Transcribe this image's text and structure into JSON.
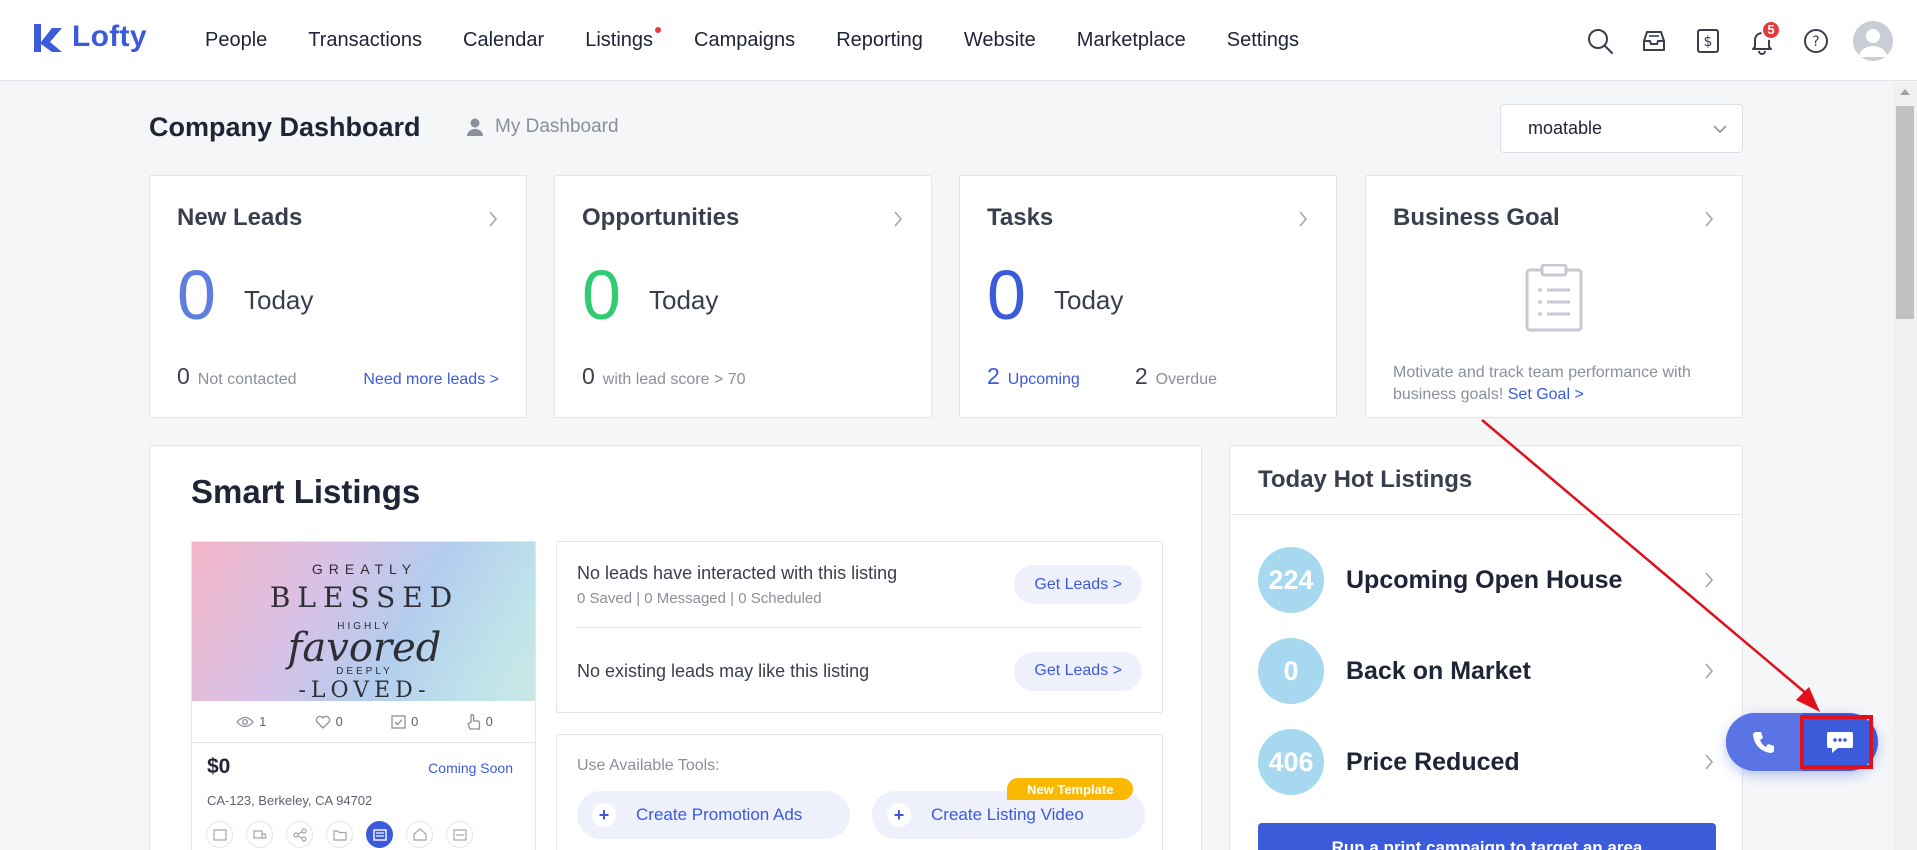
{
  "brand": {
    "name": "Lofty",
    "color": "#3b5bdb"
  },
  "nav": {
    "items": [
      {
        "label": "People",
        "dot": false
      },
      {
        "label": "Transactions",
        "dot": false
      },
      {
        "label": "Calendar",
        "dot": false
      },
      {
        "label": "Listings",
        "dot": true
      },
      {
        "label": "Campaigns",
        "dot": false
      },
      {
        "label": "Reporting",
        "dot": false
      },
      {
        "label": "Website",
        "dot": false
      },
      {
        "label": "Marketplace",
        "dot": false
      },
      {
        "label": "Settings",
        "dot": false
      }
    ],
    "icons": [
      "search-icon",
      "inbox-icon",
      "dollar-document-icon",
      "bell-icon",
      "help-icon"
    ],
    "notification_count": "5"
  },
  "header": {
    "title": "Company Dashboard",
    "my_dashboard": "My Dashboard",
    "selector_value": "moatable"
  },
  "cards": {
    "new_leads": {
      "title": "New Leads",
      "count": "0",
      "period": "Today",
      "stat_num": "0",
      "stat_label": "Not contacted",
      "link": "Need more leads >"
    },
    "opportunities": {
      "title": "Opportunities",
      "count": "0",
      "period": "Today",
      "stat_num": "0",
      "stat_label": "with lead score > 70"
    },
    "tasks": {
      "title": "Tasks",
      "count": "0",
      "period": "Today",
      "upcoming_num": "2",
      "upcoming_label": "Upcoming",
      "overdue_num": "2",
      "overdue_label": "Overdue"
    },
    "business_goal": {
      "title": "Business Goal",
      "text": "Motivate and track team performance with business goals!",
      "link": "Set Goal >"
    }
  },
  "smart_listings": {
    "title": "Smart Listings",
    "listing": {
      "image_text": [
        "GREATLY",
        "BLESSED",
        "HIGHLY",
        "favored",
        "DEEPLY",
        "-LOVED-"
      ],
      "views": "1",
      "likes": "0",
      "saves": "0",
      "shares": "0",
      "price": "$0",
      "status": "Coming Soon",
      "address": "CA-123, Berkeley, CA 94702"
    },
    "leads_rows": [
      {
        "main": "No leads have interacted with this listing",
        "sub": "0 Saved | 0 Messaged | 0 Scheduled",
        "button": "Get Leads >"
      },
      {
        "main": "No existing leads may like this listing",
        "sub": "",
        "button": "Get Leads >"
      }
    ],
    "tools_label": "Use Available Tools:",
    "tools": [
      {
        "label": "Create Promotion Ads"
      },
      {
        "label": "Create Listing Video",
        "badge": "New Template"
      }
    ]
  },
  "hot_listings": {
    "title": "Today Hot Listings",
    "rows": [
      {
        "count": "224",
        "label": "Upcoming Open House"
      },
      {
        "count": "0",
        "label": "Back on Market"
      },
      {
        "count": "406",
        "label": "Price Reduced"
      }
    ],
    "cta": "Run a print campaign to target an area"
  },
  "colors": {
    "accent": "#3b5bdb",
    "green": "#2fcc71",
    "blue_light": "#5f7fe0",
    "circle": "#a6d8ef",
    "annotation": "#e1101a"
  }
}
